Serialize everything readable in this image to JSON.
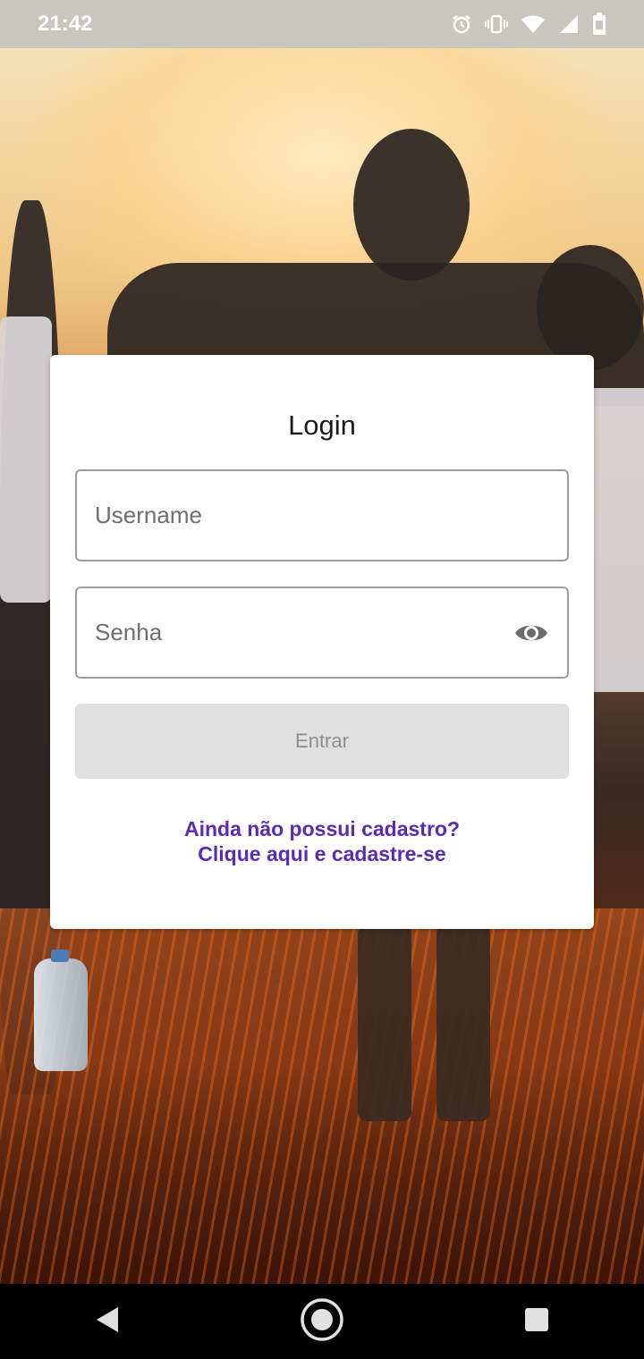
{
  "status_bar": {
    "time": "21:42",
    "icons": [
      "alarm-icon",
      "vibrate-icon",
      "wifi-icon",
      "signal-icon",
      "battery-icon"
    ]
  },
  "login": {
    "title": "Login",
    "username_placeholder": "Username",
    "password_placeholder": "Senha",
    "submit_label": "Entrar",
    "signup_line1": "Ainda não possui cadastro?",
    "signup_line2": "Clique aqui e cadastre-se"
  },
  "nav_bar": {
    "buttons": [
      "back-icon",
      "home-icon",
      "recents-icon"
    ]
  },
  "colors": {
    "accent_link": "#5b2bb5",
    "button_disabled_bg": "#e0e0e0",
    "button_disabled_text": "#8e8e8e"
  }
}
